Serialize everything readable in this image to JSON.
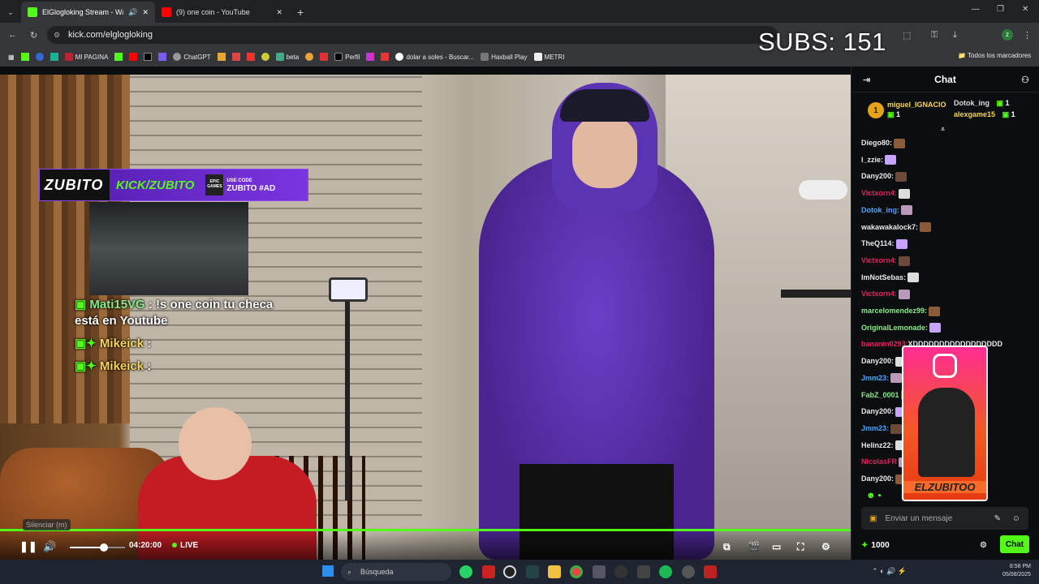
{
  "browser": {
    "tabs": [
      {
        "title": "ElGlogloking Stream - Watch l",
        "favicon_color": "#53fc18",
        "active": true
      },
      {
        "title": "(9) one coin - YouTube",
        "favicon_color": "#ff0000",
        "active": false
      }
    ],
    "new_tab_label": "+",
    "url": "kick.com/elglogloking",
    "bookmarks": [
      "MI PAGINA",
      "ChatGPT",
      "beta",
      "Perfil",
      "dolar a soles - Buscar...",
      "Haxball Play",
      "METRI"
    ],
    "all_bookmarks_label": "Todos los marcadores",
    "window_controls": [
      "—",
      "❐",
      "✕"
    ]
  },
  "stream_overlay": {
    "subs_counter": "SUBS: 151",
    "banner": {
      "logo": "ZUBITO",
      "kick": "KICK/ZUBITO",
      "epic": "EPIC GAMES",
      "code_line1": "USE CODE",
      "code_line2": "ZUBITO #AD"
    },
    "chat_lines": [
      {
        "name": "Mati15VG",
        "text": ": !s one coin",
        "text2": "tu checa está en Youtube"
      },
      {
        "name": "Mikeick",
        "text": ":"
      },
      {
        "name": "Mikeick",
        "text": ":"
      }
    ]
  },
  "player": {
    "mute_tooltip": "Silenciar (m)",
    "time": "04:20:00",
    "live_label": "LIVE",
    "progress_fraction": 1.0,
    "volume_fraction": 0.6,
    "accent_color": "#53fc18"
  },
  "chat": {
    "title": "Chat",
    "gifters": [
      {
        "rank": "1",
        "name": "miguel_IGNACIO",
        "count": "1"
      },
      {
        "name": "Dotok_ing",
        "count": "1"
      },
      {
        "name": "alexgame15",
        "count": "1"
      }
    ],
    "messages": [
      {
        "user": "Diego80:",
        "color": "#e8eaed"
      },
      {
        "user": "l_zzie:",
        "color": "#e8eaed"
      },
      {
        "user": "Dany200:",
        "color": "#e8eaed"
      },
      {
        "user": "Victxorn4:",
        "color": "#e0245e"
      },
      {
        "user": "Dotok_ing:",
        "color": "#4fa3ff"
      },
      {
        "user": "wakawakalock7:",
        "color": "#e8eaed"
      },
      {
        "user": "TheQ114:",
        "color": "#e8eaed"
      },
      {
        "user": "Victxorn4:",
        "color": "#e0245e"
      },
      {
        "user": "ImNotSebas:",
        "color": "#e8eaed"
      },
      {
        "user": "Victxorn4:",
        "color": "#e0245e"
      },
      {
        "user": "marcelomendez99:",
        "color": "#8be88b"
      },
      {
        "user": "OriginalLemonade:",
        "color": "#8be88b"
      },
      {
        "user": "bananin0293:",
        "color": "#e0245e",
        "text": "XDDDDDDDDDDDDDDDDD"
      },
      {
        "user": "Dany200:",
        "color": "#e8eaed"
      },
      {
        "user": "Jmm23:",
        "color": "#4fa3ff"
      },
      {
        "user": "FabZ_0001",
        "color": "#8be88b"
      },
      {
        "user": "Dany200:",
        "color": "#e8eaed"
      },
      {
        "user": "Jmm23:",
        "color": "#4fa3ff"
      },
      {
        "user": "Helinz22:",
        "color": "#e8eaed"
      },
      {
        "user": "NicolasFR",
        "color": "#e0245e"
      },
      {
        "user": "Dany200:",
        "color": "#e8eaed"
      }
    ],
    "instagram_overlay_name": "ELZUBITOO",
    "input_placeholder": "Enviar un mensaje",
    "points": "1000",
    "send_label": "Chat"
  },
  "taskbar": {
    "search_placeholder": "Búsqueda",
    "time": "8:58 PM",
    "date": "05/08/2025"
  }
}
